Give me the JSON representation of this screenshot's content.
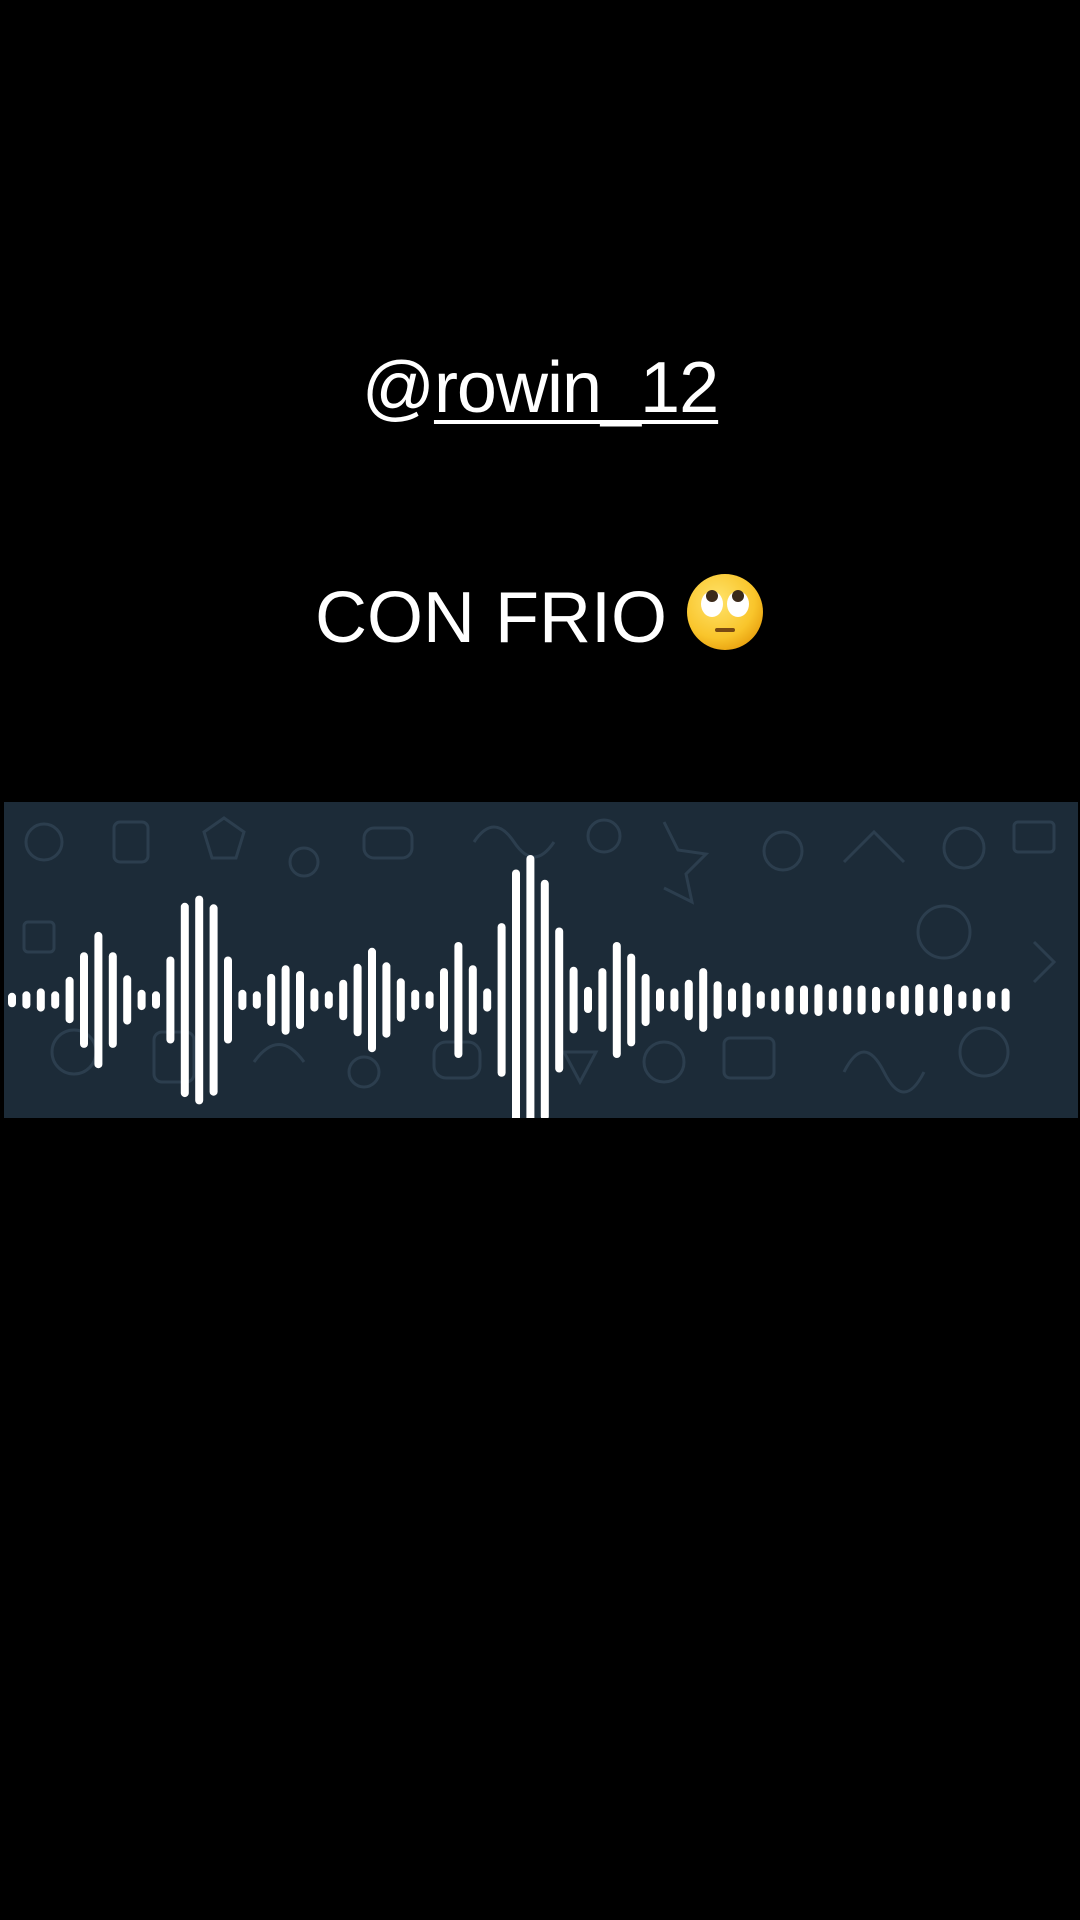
{
  "overlay": {
    "username_prefix": "@",
    "username_handle": "rowin_12",
    "caption": "CON FRIO",
    "caption_emoji": "face-with-rolling-eyes"
  },
  "waveform": {
    "panel_color": "#1c2b38",
    "bar_color": "#ffffff",
    "levels": [
      0.05,
      0.06,
      0.08,
      0.06,
      0.16,
      0.33,
      0.47,
      0.33,
      0.17,
      0.07,
      0.06,
      0.3,
      0.67,
      0.72,
      0.66,
      0.3,
      0.07,
      0.06,
      0.18,
      0.24,
      0.2,
      0.08,
      0.06,
      0.14,
      0.25,
      0.36,
      0.26,
      0.15,
      0.07,
      0.06,
      0.22,
      0.4,
      0.24,
      0.08,
      0.53,
      0.9,
      1.0,
      0.83,
      0.5,
      0.23,
      0.09,
      0.22,
      0.4,
      0.32,
      0.18,
      0.08,
      0.08,
      0.14,
      0.22,
      0.13,
      0.08,
      0.12,
      0.06,
      0.08,
      0.1,
      0.1,
      0.11,
      0.08,
      0.1,
      0.1,
      0.09,
      0.06,
      0.1,
      0.11,
      0.09,
      0.11,
      0.06,
      0.08,
      0.06,
      0.08
    ]
  }
}
